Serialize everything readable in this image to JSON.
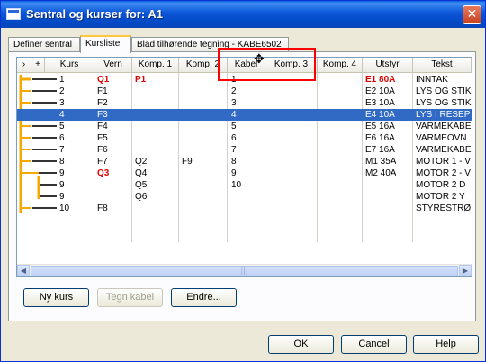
{
  "window": {
    "title": "Sentral og kurser for: A1",
    "close_glyph": "✕"
  },
  "tabs": [
    {
      "label": "Definer sentral",
      "active": false
    },
    {
      "label": "Kursliste",
      "active": true
    },
    {
      "label": "Blad tilhørende tegning - KABE6502",
      "active": false
    }
  ],
  "grid": {
    "columns": [
      "›",
      "+",
      "Kurs",
      "Vern",
      "Komp. 1",
      "Komp. 2",
      "Kabel",
      "Komp. 3",
      "Komp. 4",
      "Utstyr",
      "Tekst"
    ],
    "rows": [
      {
        "kurs": "1",
        "vern": "Q1",
        "vern_red": true,
        "komp1": "P1",
        "komp1_red": true,
        "komp2": "",
        "kabel": "1",
        "utstyr": "E1 80A",
        "utstyr_red": true,
        "tekst": "INNTAK"
      },
      {
        "kurs": "2",
        "vern": "F1",
        "komp1": "",
        "komp2": "",
        "kabel": "2",
        "utstyr": "E2 10A",
        "tekst": "LYS OG STIK"
      },
      {
        "kurs": "3",
        "vern": "F2",
        "komp1": "",
        "komp2": "",
        "kabel": "3",
        "utstyr": "E3 10A",
        "tekst": "LYS OG STIK"
      },
      {
        "kurs": "4",
        "vern": "F3",
        "komp1": "",
        "komp2": "",
        "kabel": "4",
        "utstyr": "E4 10A",
        "tekst": "LYS I RESEP",
        "selected": true
      },
      {
        "kurs": "5",
        "vern": "F4",
        "komp1": "",
        "komp2": "",
        "kabel": "5",
        "utstyr": "E5 16A",
        "tekst": "VARMEKABE"
      },
      {
        "kurs": "6",
        "vern": "F5",
        "komp1": "",
        "komp2": "",
        "kabel": "6",
        "utstyr": "E6 16A",
        "tekst": "VARMEOVN"
      },
      {
        "kurs": "7",
        "vern": "F6",
        "komp1": "",
        "komp2": "",
        "kabel": "7",
        "utstyr": "E7 16A",
        "tekst": "VARMEKABE"
      },
      {
        "kurs": "8",
        "vern": "F7",
        "komp1": "Q2",
        "komp2": "F9",
        "kabel": "8",
        "utstyr": "M1 35A",
        "tekst": "MOTOR 1 - V"
      },
      {
        "kurs": "9",
        "vern": "Q3",
        "vern_red": true,
        "komp1": "Q4",
        "komp2": "",
        "kabel": "9",
        "utstyr": "M2 40A",
        "tekst": "MOTOR 2 - V"
      },
      {
        "kurs": "9",
        "vern": "",
        "komp1": "Q5",
        "komp2": "",
        "kabel": "10",
        "utstyr": "",
        "tekst": "MOTOR 2 D"
      },
      {
        "kurs": "9",
        "vern": "",
        "komp1": "Q6",
        "komp2": "",
        "kabel": "",
        "utstyr": "",
        "tekst": "MOTOR 2 Y"
      },
      {
        "kurs": "10",
        "vern": "F8",
        "komp1": "",
        "komp2": "",
        "kabel": "",
        "utstyr": "",
        "tekst": "STYRESTRØ"
      }
    ]
  },
  "scrollbar": {
    "left_arrow": "◀",
    "right_arrow": "▶",
    "grip": "|||"
  },
  "panel_buttons": {
    "ny_kurs": "Ny kurs",
    "tegn_kabel": "Tegn kabel",
    "endre": "Endre..."
  },
  "dialog_buttons": {
    "ok": "OK",
    "cancel": "Cancel",
    "help": "Help"
  },
  "cursor_glyph": "✥",
  "colors": {
    "accent": "#316ac5",
    "red_text": "#e00000",
    "highlight_box": "#ff0000",
    "tree_line": "#f5a800"
  }
}
